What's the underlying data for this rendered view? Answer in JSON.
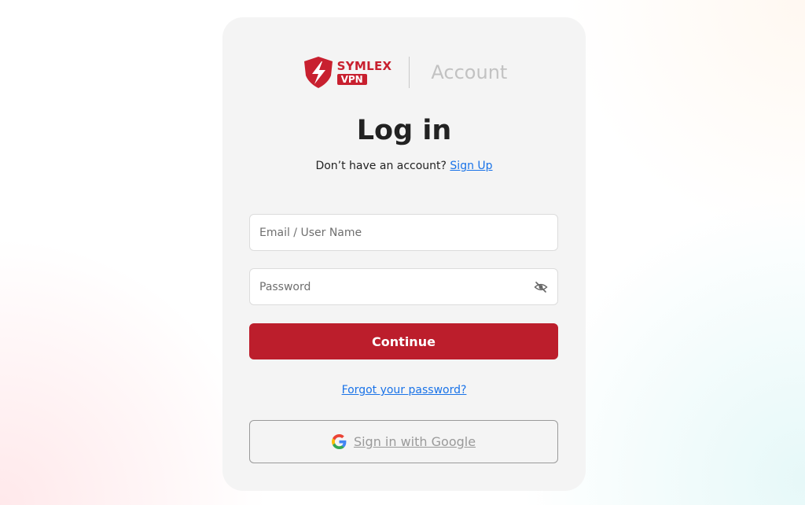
{
  "header": {
    "brand_name": "SYMLEX",
    "brand_badge": "VPN",
    "section_label": "Account"
  },
  "title": "Log in",
  "signup_prompt": {
    "text": "Don’t have an account? ",
    "link_label": "Sign Up"
  },
  "form": {
    "email_placeholder": "Email / User Name",
    "email_value": "",
    "password_placeholder": "Password",
    "password_value": "",
    "continue_label": "Continue"
  },
  "forgot_label": "Forgot your password?",
  "google_label": "Sign in with Google",
  "colors": {
    "brand_red": "#bc1e2c",
    "link_blue": "#1a73e8",
    "card_bg": "#f4f4f4"
  },
  "icons": [
    "symlex-shield-logo",
    "eye-slash-icon",
    "google-icon"
  ]
}
